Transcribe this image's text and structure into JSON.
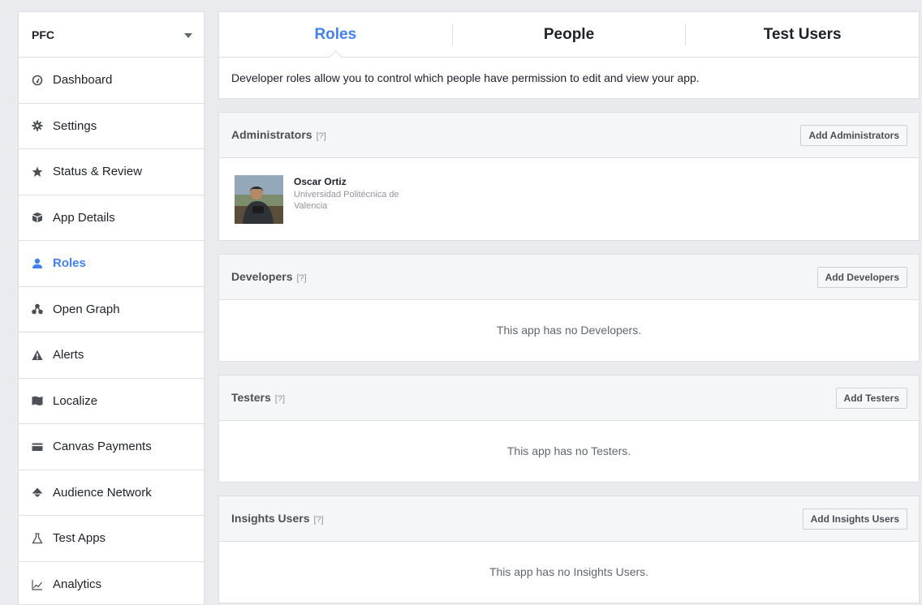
{
  "app_selector": {
    "name": "PFC"
  },
  "sidebar": {
    "items": [
      {
        "label": "Dashboard",
        "icon": "dashboard-icon"
      },
      {
        "label": "Settings",
        "icon": "gear-icon"
      },
      {
        "label": "Status & Review",
        "icon": "star-icon"
      },
      {
        "label": "App Details",
        "icon": "box-icon"
      },
      {
        "label": "Roles",
        "icon": "person-icon",
        "active": true
      },
      {
        "label": "Open Graph",
        "icon": "graph-nodes-icon"
      },
      {
        "label": "Alerts",
        "icon": "warning-icon"
      },
      {
        "label": "Localize",
        "icon": "map-icon"
      },
      {
        "label": "Canvas Payments",
        "icon": "card-icon"
      },
      {
        "label": "Audience Network",
        "icon": "audience-network-icon"
      },
      {
        "label": "Test Apps",
        "icon": "flask-icon"
      },
      {
        "label": "Analytics",
        "icon": "line-chart-icon"
      }
    ]
  },
  "tabs": {
    "items": [
      {
        "label": "Roles",
        "active": true
      },
      {
        "label": "People"
      },
      {
        "label": "Test Users"
      }
    ]
  },
  "intro_text": "Developer roles allow you to control which people have permission to edit and view your app.",
  "sections": {
    "administrators": {
      "title": "Administrators",
      "help": "[?]",
      "button": "Add Administrators",
      "members": [
        {
          "name": "Oscar Ortiz",
          "subtitle": "Universidad Politécnica de Valencia"
        }
      ]
    },
    "developers": {
      "title": "Developers",
      "help": "[?]",
      "button": "Add Developers",
      "empty": "This app has no Developers."
    },
    "testers": {
      "title": "Testers",
      "help": "[?]",
      "button": "Add Testers",
      "empty": "This app has no Testers."
    },
    "insights": {
      "title": "Insights Users",
      "help": "[?]",
      "button": "Add Insights Users",
      "empty": "This app has no Insights Users."
    }
  },
  "colors": {
    "accent": "#4080ff",
    "background": "#e9ebee",
    "border": "#dddfe2",
    "section_header": "#f5f6f7"
  }
}
